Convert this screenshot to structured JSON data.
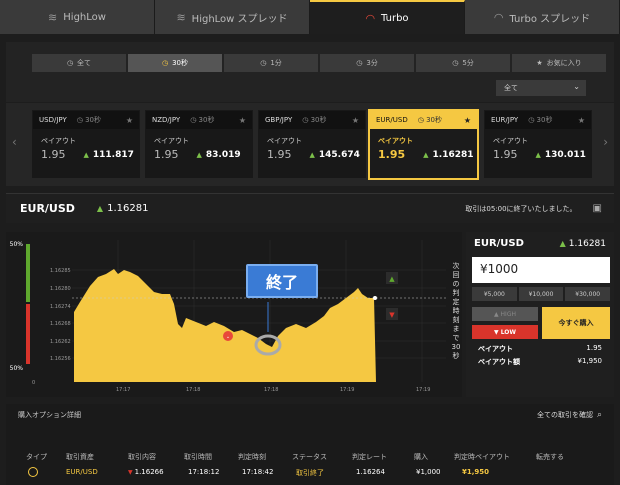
{
  "product_tabs": [
    {
      "label": "HighLow",
      "icon": "highlow-icon"
    },
    {
      "label": "HighLow スプレッド",
      "icon": "highlow-spread-icon"
    },
    {
      "label": "Turbo",
      "icon": "turbo-gauge-icon"
    },
    {
      "label": "Turbo スプレッド",
      "icon": "turbo-spread-icon"
    }
  ],
  "active_product": "Turbo",
  "filter_tabs": [
    {
      "label": "全て",
      "icon": "clock-icon"
    },
    {
      "label": "30秒",
      "icon": "clock-icon"
    },
    {
      "label": "1分",
      "icon": "clock-icon"
    },
    {
      "label": "3分",
      "icon": "clock-icon"
    },
    {
      "label": "5分",
      "icon": "clock-icon"
    },
    {
      "label": "お気に入り",
      "icon": "star-icon"
    }
  ],
  "active_filter": "30秒",
  "category_select": "全て",
  "payout_label": "ペイアウト",
  "assets": [
    {
      "pair": "USD/JPY",
      "duration": "30秒",
      "payout": "1.95",
      "rate": "111.817"
    },
    {
      "pair": "NZD/JPY",
      "duration": "30秒",
      "payout": "1.95",
      "rate": "83.019"
    },
    {
      "pair": "GBP/JPY",
      "duration": "30秒",
      "payout": "1.95",
      "rate": "145.674"
    },
    {
      "pair": "EUR/USD",
      "duration": "30秒",
      "payout": "1.95",
      "rate": "1.16281"
    },
    {
      "pair": "EUR/JPY",
      "duration": "30秒",
      "payout": "1.95",
      "rate": "130.011"
    }
  ],
  "selected_asset": {
    "pair": "EUR/USD",
    "rate": "1.16281",
    "status_message": "取引は05:00に終了いたしました。"
  },
  "chart": {
    "end_label": "終了",
    "side_text": "次回の判定時刻まで30秒",
    "pct_top": "50%",
    "pct_bottom": "50%",
    "y_ticks": [
      "1.16285",
      "1.16280",
      "1.16274",
      "1.16268",
      "1.16262",
      "1.16256"
    ],
    "x_ticks": [
      "17:17",
      "17:18",
      "17:18",
      "17:19",
      "17:19"
    ],
    "accent_color": "#f5c842"
  },
  "chart_data": {
    "type": "area",
    "x": [
      "17:17",
      "17:18",
      "17:18",
      "17:19",
      "17:19"
    ],
    "values": [
      1.16276,
      1.16281,
      1.16262,
      1.16275,
      1.16278
    ],
    "ylim": [
      1.1625,
      1.1629
    ]
  },
  "trade_panel": {
    "pair": "EUR/USD",
    "rate": "1.16281",
    "amount": "¥1000",
    "presets": [
      "¥5,000",
      "¥10,000",
      "¥30,000"
    ],
    "high_label": "HIGH",
    "low_label": "LOW",
    "buy_label": "今すぐ購入",
    "payout_label": "ペイアウト",
    "payout_value": "1.95",
    "payout_amount_label": "ペイアウト額",
    "payout_amount_value": "¥1,950"
  },
  "details": {
    "title": "購入オプション詳細",
    "confirm_all": "全ての取引を確認",
    "headers": [
      "タイプ",
      "取引資産",
      "取引内容",
      "取引時間",
      "判定時刻",
      "ステータス",
      "判定レート",
      "購入",
      "判定時ペイアウト",
      "転売する"
    ],
    "row": {
      "asset": "EUR/USD",
      "content": "1.16266",
      "trade_time": "17:18:12",
      "judge_time": "17:18:42",
      "status": "取引終了",
      "judge_rate": "1.16264",
      "purchase": "¥1,000",
      "payout": "¥1,950"
    }
  }
}
